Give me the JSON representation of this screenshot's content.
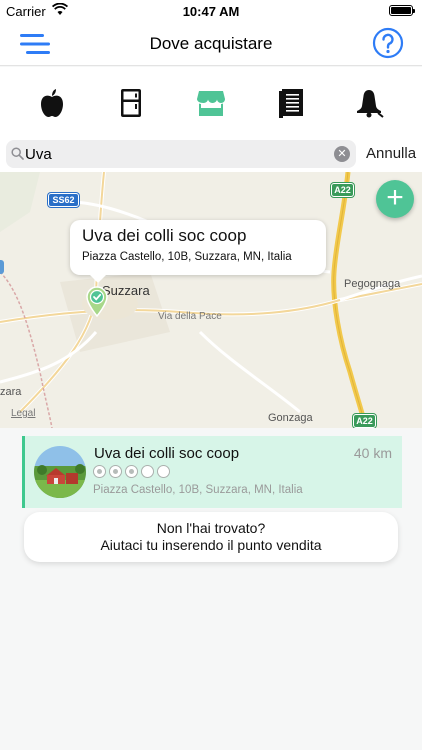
{
  "status_bar": {
    "carrier": "Carrier",
    "time": "10:47 AM"
  },
  "nav": {
    "title": "Dove acquistare"
  },
  "categories": [
    "apple-icon",
    "fridge-icon",
    "store-icon",
    "book-icon",
    "bell-icon"
  ],
  "search": {
    "value": "Uva",
    "cancel_label": "Annulla"
  },
  "map": {
    "road_labels": [
      "SS62",
      "A22",
      "A22"
    ],
    "towns": [
      "Suzzara",
      "Pegognaga",
      "Gonzaga",
      "zara"
    ],
    "street": "Via della Pace",
    "legal": "Legal",
    "callout": {
      "name": "Uva dei colli soc coop",
      "address": "Piazza Castello, 10B, Suzzara, MN, Italia"
    }
  },
  "results": [
    {
      "name": "Uva dei colli soc coop",
      "distance": "40 km",
      "address": "Piazza Castello, 10B, Suzzara, MN, Italia"
    }
  ],
  "not_found": {
    "line1": "Non l'hai trovato?",
    "line2": "Aiutaci tu inserendo il punto vendita"
  },
  "colors": {
    "accent": "#4fc496",
    "help_blue": "#2e7cf6",
    "menu_blue": "#2e7cf6"
  }
}
